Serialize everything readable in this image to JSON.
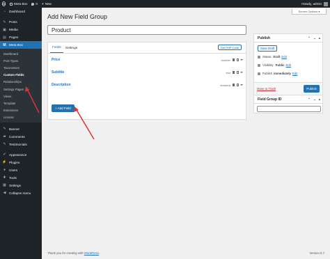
{
  "admin_bar": {
    "site_name": "Meta Box",
    "comments_count": "0",
    "new_label": "New",
    "greeting": "Howdy, admin"
  },
  "sidebar": {
    "dashboard": "Dashboard",
    "posts": "Posts",
    "media": "Media",
    "pages": "Pages",
    "metabox": "Meta Box",
    "metabox_sub": [
      "Dashboard",
      "Post Types",
      "Taxonomies",
      "Custom Fields",
      "Relationships",
      "Settings Pages",
      "Views",
      "Template",
      "Extensions",
      "License"
    ],
    "banner": "Banner",
    "comments": "Comments",
    "testimonials": "Testimonials",
    "appearance": "Appearance",
    "plugins": "Plugins",
    "users": "Users",
    "tools": "Tools",
    "settings": "Settings",
    "collapse": "Collapse menu"
  },
  "header": {
    "title": "Add New Field Group",
    "screen_options": "Screen Options ▾"
  },
  "editor": {
    "title_value": "Product",
    "tabs": [
      "Fields",
      "Settings"
    ],
    "get_php_code": "Get PHP Code",
    "fields": [
      {
        "name": "Price",
        "type": "number"
      },
      {
        "name": "Subtitle",
        "type": "text"
      },
      {
        "name": "Description",
        "type": "textarea"
      }
    ],
    "add_field": "+ Add Field"
  },
  "publish": {
    "title": "Publish",
    "save_draft": "Save Draft",
    "status_label": "Status:",
    "status_value": "Draft",
    "visibility_label": "Visibility:",
    "visibility_value": "Public",
    "publish_label": "Publish",
    "publish_value": "immediately",
    "edit": "Edit",
    "trash": "Move to Trash",
    "publish_button": "Publish"
  },
  "field_group_id": {
    "title": "Field Group ID"
  },
  "footer": {
    "thanks_prefix": "Thank you for creating with",
    "wordpress": "WordPress",
    "version": "Version 5.7"
  },
  "colors": {
    "accent": "#2271b1",
    "sidebar_bg": "#1d2327",
    "arrow": "#d63638"
  },
  "icons": [
    "wordpress-logo-icon",
    "comment-icon",
    "plus-icon",
    "dashboard-icon",
    "pin-icon",
    "media-icon",
    "page-icon",
    "metabox-icon",
    "arrow-annotation"
  ]
}
